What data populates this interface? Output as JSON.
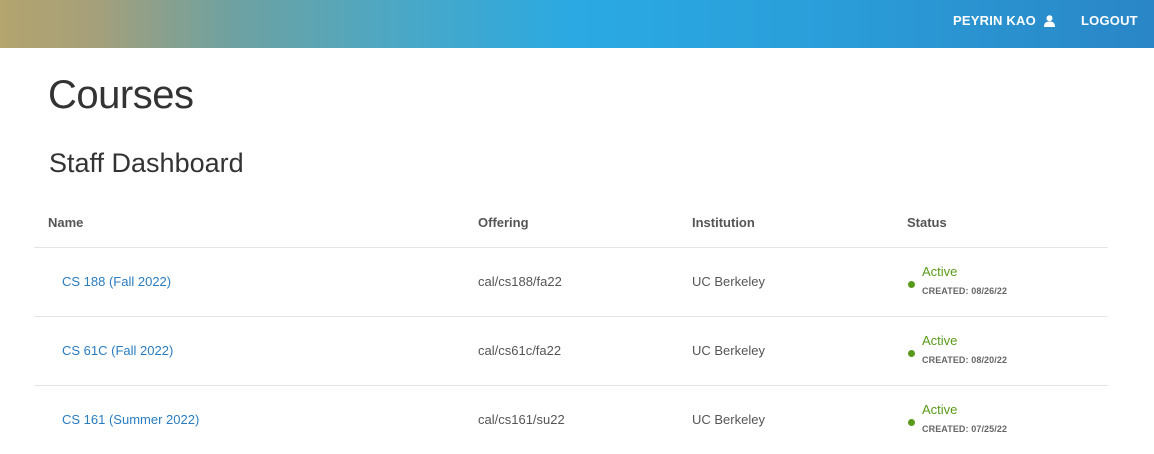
{
  "header": {
    "user_name": "PEYRIN KAO",
    "user_icon": "user-icon",
    "logout_label": "LOGOUT"
  },
  "page": {
    "title": "Courses",
    "section_title": "Staff Dashboard"
  },
  "table": {
    "columns": [
      "Name",
      "Offering",
      "Institution",
      "Status"
    ],
    "rows": [
      {
        "name": "CS 188 (Fall 2022)",
        "offering": "cal/cs188/fa22",
        "institution": "UC Berkeley",
        "status": "Active",
        "created": "CREATED: 08/26/22"
      },
      {
        "name": "CS 61C (Fall 2022)",
        "offering": "cal/cs61c/fa22",
        "institution": "UC Berkeley",
        "status": "Active",
        "created": "CREATED: 08/20/22"
      },
      {
        "name": "CS 161 (Summer 2022)",
        "offering": "cal/cs161/su22",
        "institution": "UC Berkeley",
        "status": "Active",
        "created": "CREATED: 07/25/22"
      }
    ]
  },
  "colors": {
    "link": "#2a7cc0",
    "status_active": "#5a9a1a"
  }
}
